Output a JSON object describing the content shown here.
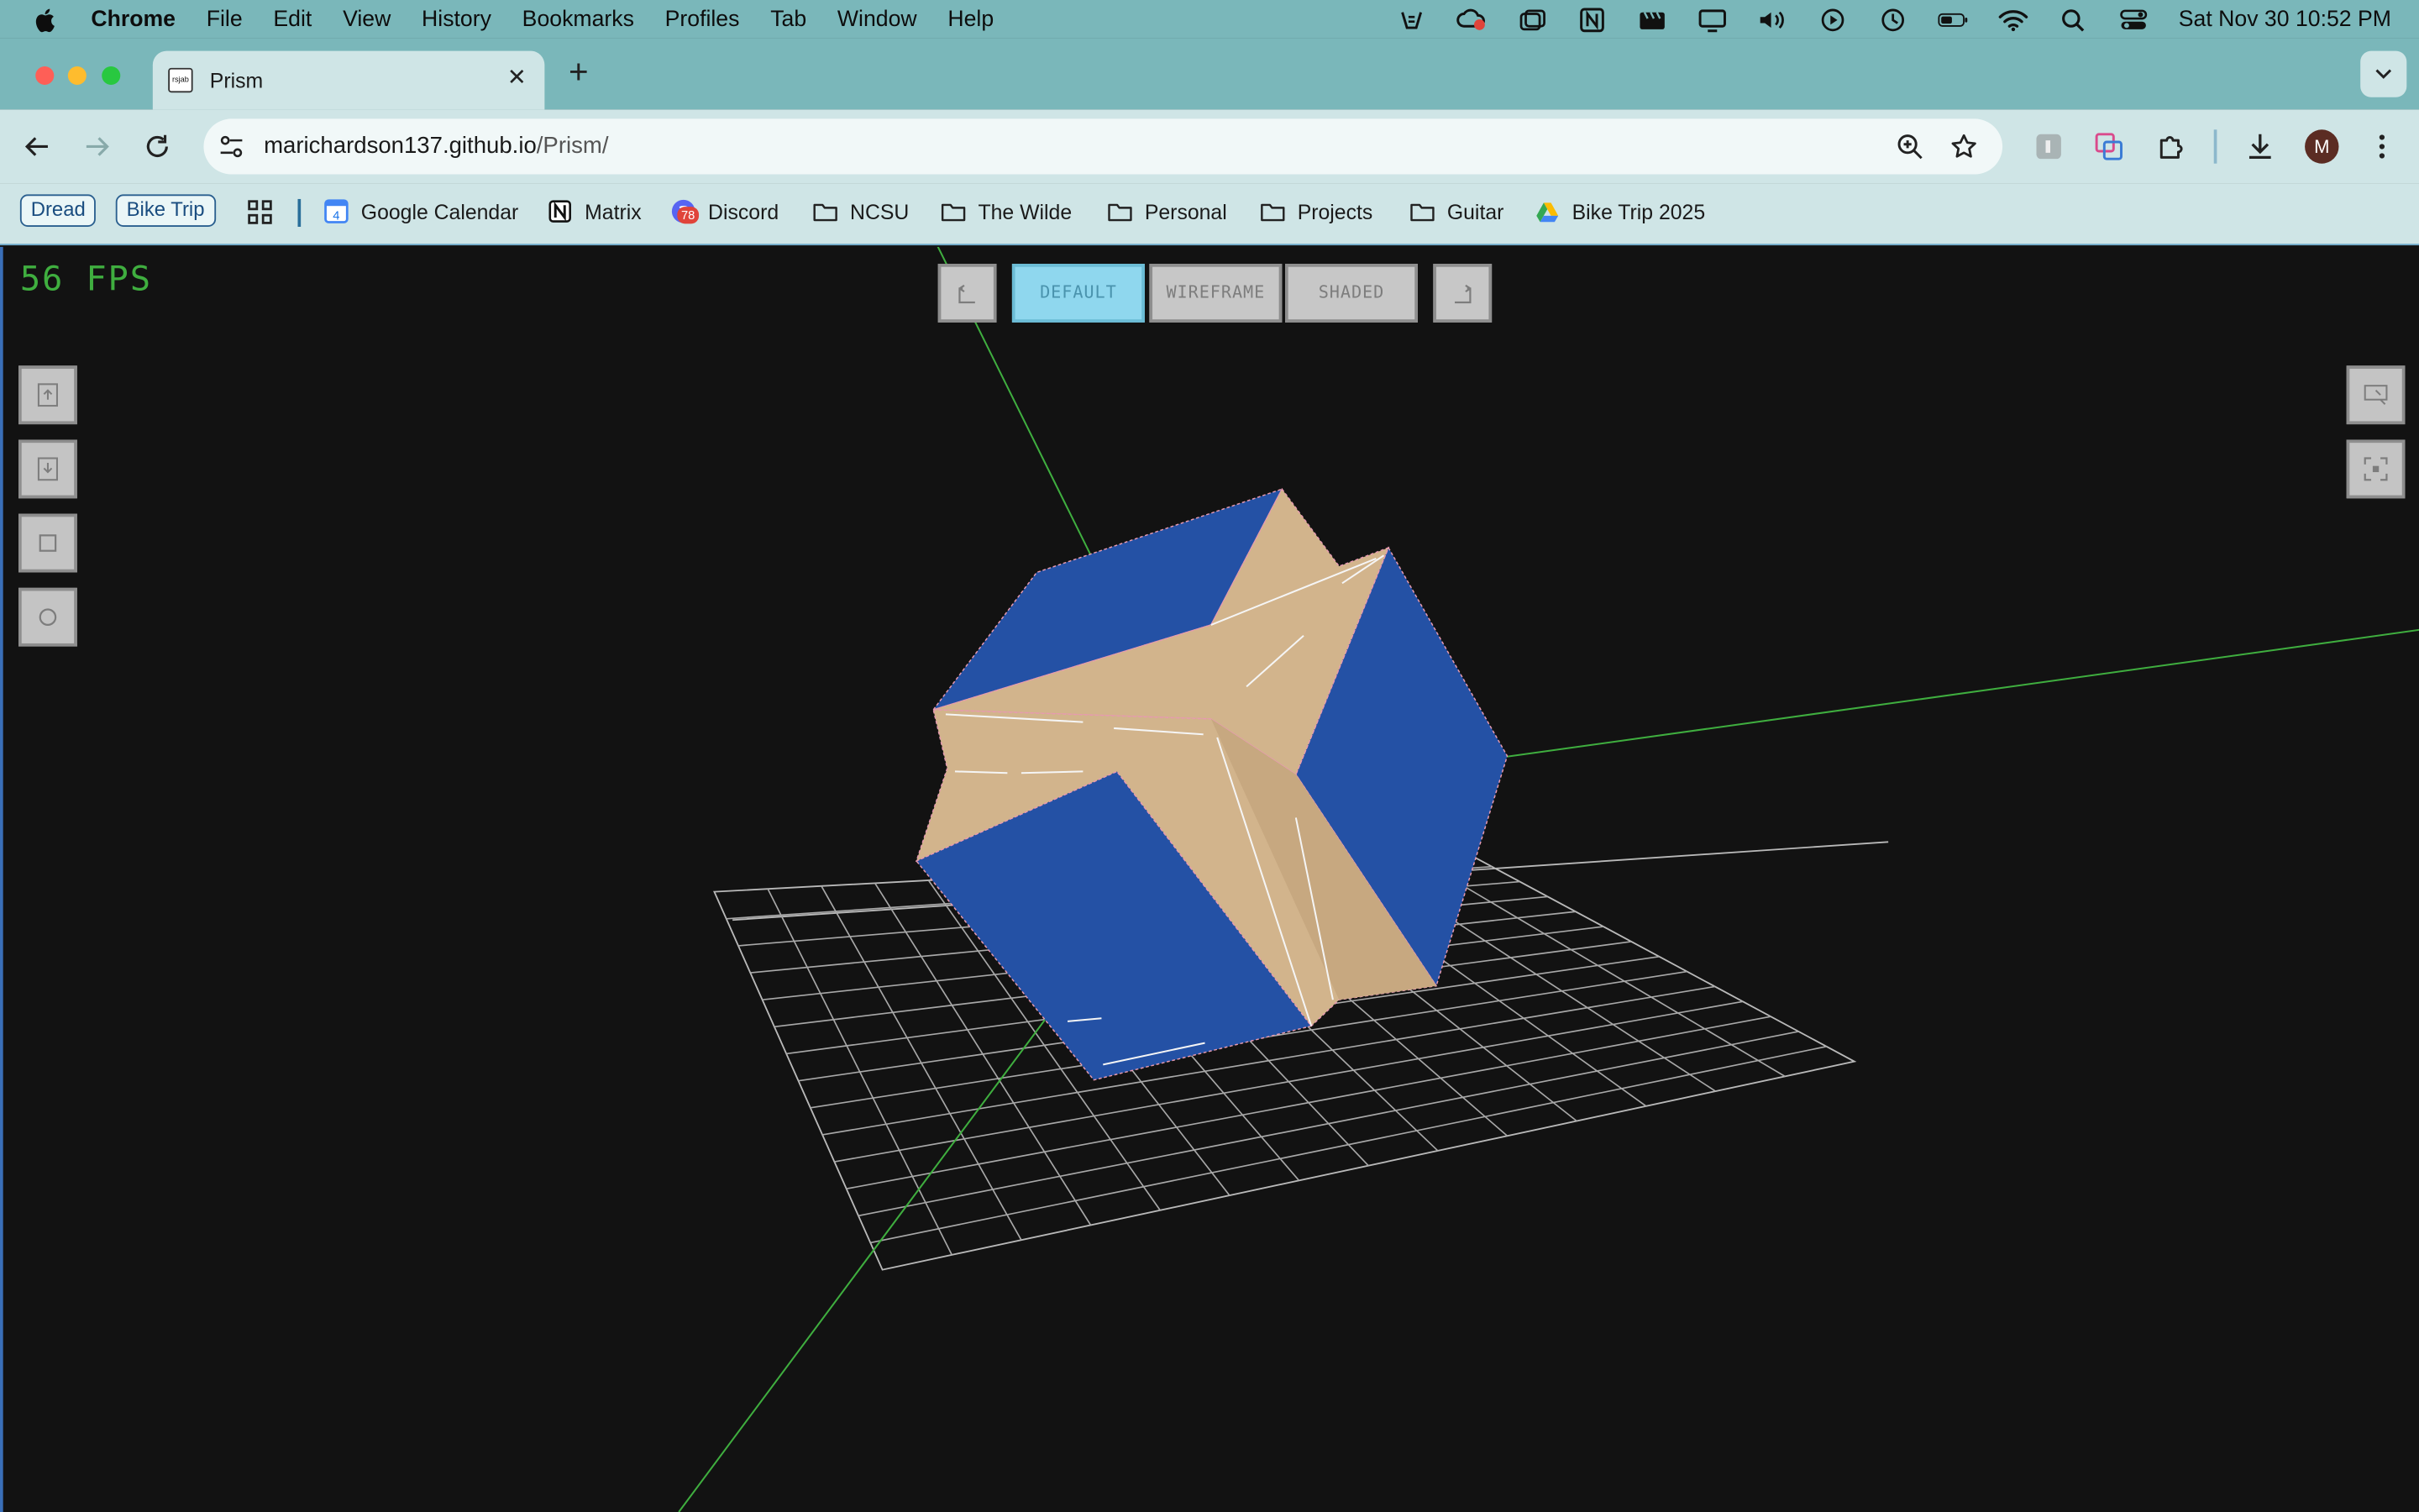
{
  "menubar": {
    "app_name": "Chrome",
    "items": [
      "File",
      "Edit",
      "View",
      "History",
      "Bookmarks",
      "Profiles",
      "Tab",
      "Window",
      "Help"
    ],
    "clock": "Sat Nov 30  10:52 PM"
  },
  "tab": {
    "title": "Prism",
    "favicon_text": "rsjab"
  },
  "omnibox": {
    "host": "marichardson137.github.io",
    "path": "/Prism/"
  },
  "profile": {
    "initial": "M"
  },
  "bookmarks": {
    "chips": [
      "Dread",
      "Bike Trip"
    ],
    "items": [
      {
        "label": "Google Calendar",
        "icon": "google-calendar-icon"
      },
      {
        "label": "Matrix",
        "icon": "notion-icon"
      },
      {
        "label": "Discord",
        "icon": "discord-icon",
        "badge": "78"
      },
      {
        "label": "NCSU",
        "icon": "folder-icon"
      },
      {
        "label": "The Wilde",
        "icon": "folder-icon"
      },
      {
        "label": "Personal",
        "icon": "folder-icon"
      },
      {
        "label": "Projects",
        "icon": "folder-icon"
      },
      {
        "label": "Guitar",
        "icon": "folder-icon"
      },
      {
        "label": "Bike Trip 2025",
        "icon": "google-drive-icon"
      }
    ],
    "calendar_day": "4"
  },
  "viewer": {
    "fps": "56 FPS",
    "modes": [
      "DEFAULT",
      "WIREFRAME",
      "SHADED"
    ],
    "active_mode": "DEFAULT",
    "colors": {
      "background": "#121212",
      "blue_face": "#2451a5",
      "tan_face": "#d2b48c",
      "axis": "#3fae3f",
      "grid": "#b9b9b9",
      "active_button": "#8fd7ee"
    }
  }
}
